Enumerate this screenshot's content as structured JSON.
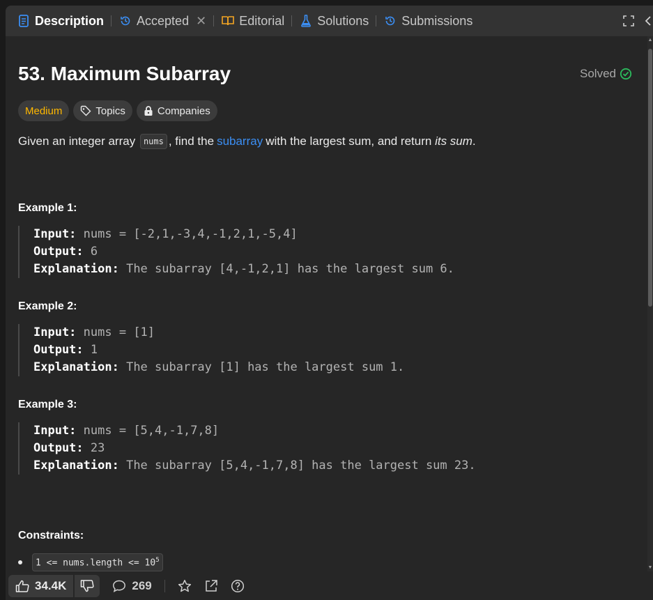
{
  "tabs": [
    {
      "label": "Description",
      "icon": "description-icon",
      "active": true
    },
    {
      "label": "Accepted",
      "icon": "history-icon",
      "closable": true
    },
    {
      "label": "Editorial",
      "icon": "book-icon"
    },
    {
      "label": "Solutions",
      "icon": "flask-icon"
    },
    {
      "label": "Submissions",
      "icon": "history-icon"
    }
  ],
  "problem": {
    "title": "53. Maximum Subarray",
    "status": "Solved",
    "tags": {
      "difficulty": "Medium",
      "topics": "Topics",
      "companies": "Companies"
    },
    "description": {
      "prefix": "Given an integer array",
      "code": "nums",
      "middle": ", find the",
      "link": "subarray",
      "suffix": "with the largest sum, and return",
      "emphasis": "its sum",
      "end": "."
    }
  },
  "examples": [
    {
      "title": "Example 1:",
      "input_label": "Input:",
      "input": "nums = [-2,1,-3,4,-1,2,1,-5,4]",
      "output_label": "Output:",
      "output": "6",
      "explanation_label": "Explanation:",
      "explanation": "The subarray [4,-1,2,1] has the largest sum 6."
    },
    {
      "title": "Example 2:",
      "input_label": "Input:",
      "input": "nums = [1]",
      "output_label": "Output:",
      "output": "1",
      "explanation_label": "Explanation:",
      "explanation": "The subarray [1] has the largest sum 1."
    },
    {
      "title": "Example 3:",
      "input_label": "Input:",
      "input": "nums = [5,4,-1,7,8]",
      "output_label": "Output:",
      "output": "23",
      "explanation_label": "Explanation:",
      "explanation": "The subarray [5,4,-1,7,8] has the largest sum 23."
    }
  ],
  "constraints": {
    "title": "Constraints:",
    "items": [
      {
        "text": "1 <= nums.length <= 10",
        "sup": "5"
      }
    ]
  },
  "footer": {
    "likes": "34.4K",
    "comments": "269"
  },
  "colors": {
    "accent_blue": "#3b8ef3",
    "medium": "#ffb800",
    "solved_check": "#2cbb5d"
  }
}
